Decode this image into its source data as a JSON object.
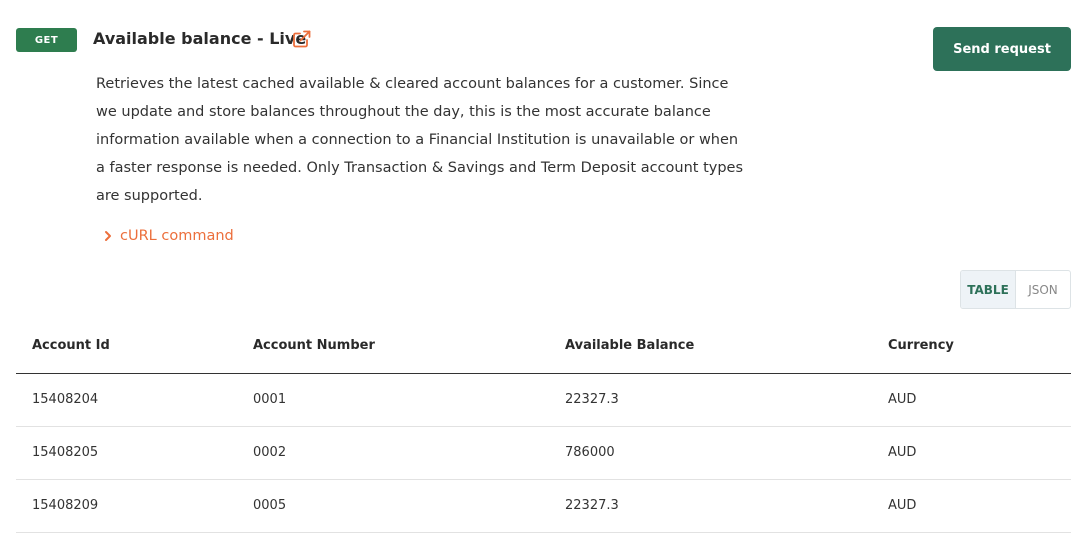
{
  "endpoint": {
    "method": "GET",
    "title": "Available balance - Live",
    "send_label": "Send request",
    "description": "Retrieves the latest cached available & cleared account balances for a customer. Since we update and store balances throughout the day, this is the most accurate balance information available when a connection to a Financial Institution is unavailable or when a faster response is needed. Only Transaction & Savings and Term Deposit account types are supported.",
    "curl_label": "cURL command"
  },
  "view_toggle": {
    "tabs": [
      "TABLE",
      "JSON"
    ],
    "active": "TABLE"
  },
  "table": {
    "headers": [
      "Account Id",
      "Account Number",
      "Available Balance",
      "Currency"
    ],
    "rows": [
      [
        "15408204",
        "0001",
        "22327.3",
        "AUD"
      ],
      [
        "15408205",
        "0002",
        "786000",
        "AUD"
      ],
      [
        "15408209",
        "0005",
        "22327.3",
        "AUD"
      ]
    ]
  },
  "colors": {
    "badge": "#2e7d4f",
    "primary_button": "#2d7159",
    "link_accent": "#ec6f3c"
  }
}
